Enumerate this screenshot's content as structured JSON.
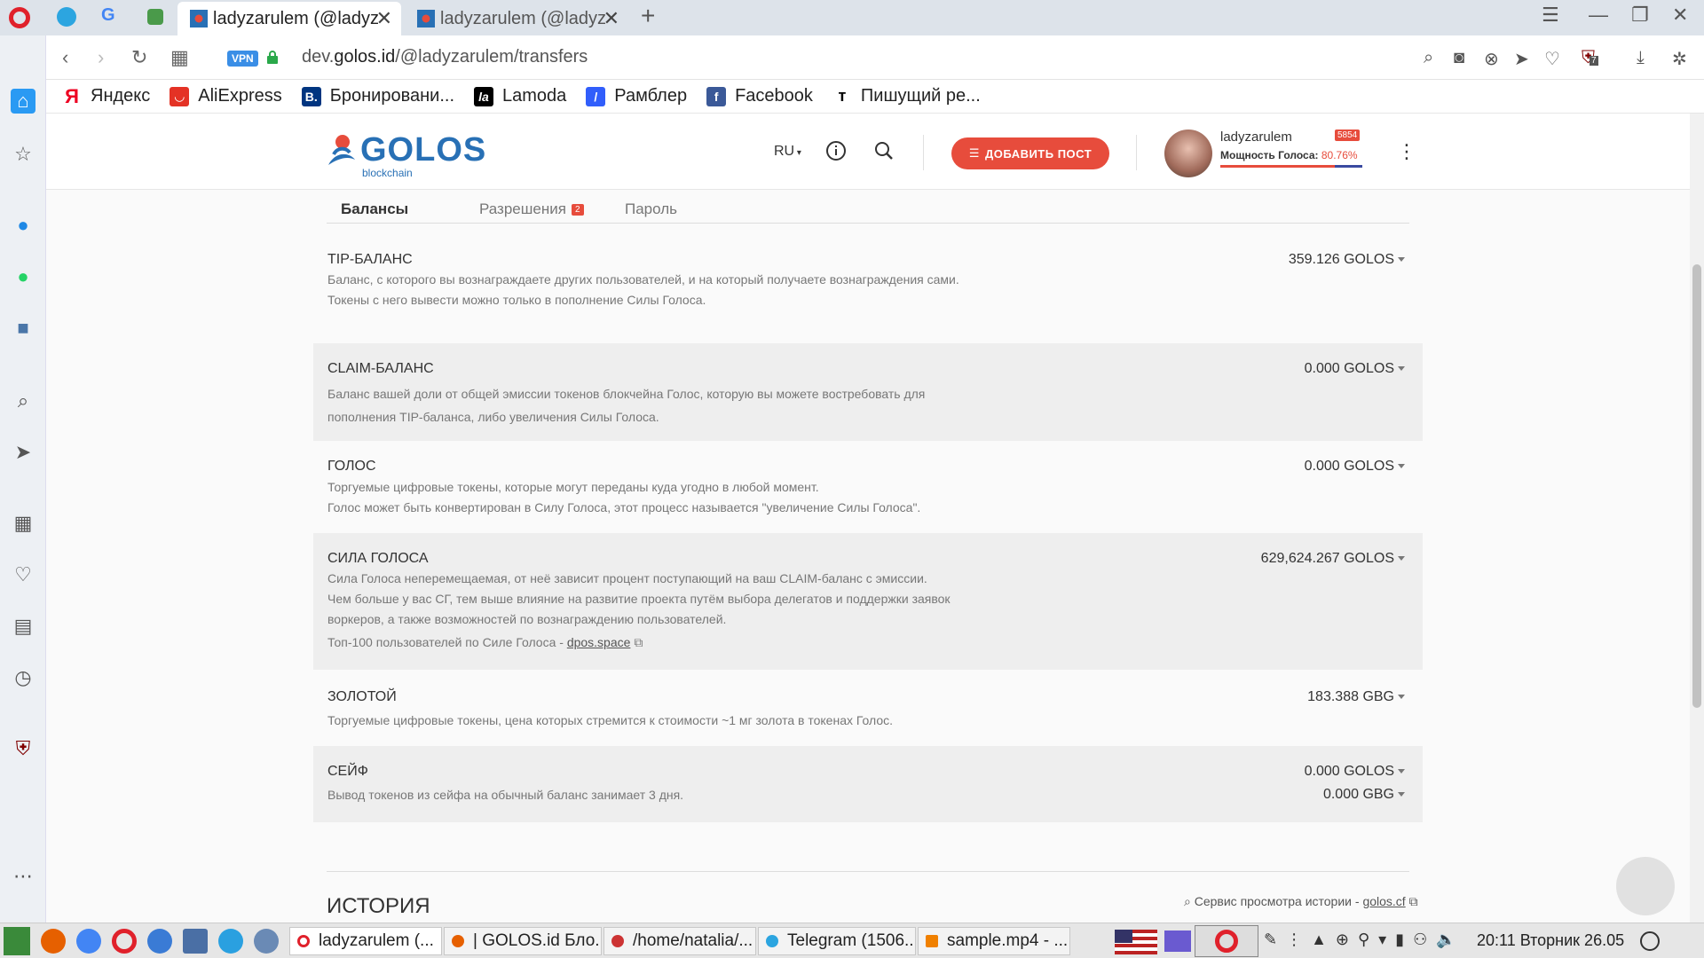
{
  "browser": {
    "tabs": [
      {
        "label": "ladyzarulem (@ladyz",
        "active": true
      },
      {
        "label": "ladyzarulem (@ladyz",
        "active": false
      }
    ],
    "url_prefix": "dev.",
    "url_domain": "golos.id",
    "url_path": "/@ladyzarulem/transfers",
    "vpn_label": "VPN",
    "bookmarks": [
      {
        "label": "Яндекс",
        "icon": "yandex-icon"
      },
      {
        "label": "AliExpress",
        "icon": "aliexpress-icon"
      },
      {
        "label": "Бронировани...",
        "icon": "booking-icon"
      },
      {
        "label": "Lamoda",
        "icon": "lamoda-icon"
      },
      {
        "label": "Рамблер",
        "icon": "rambler-icon"
      },
      {
        "label": "Facebook",
        "icon": "facebook-icon"
      },
      {
        "label": "Пишущий ре...",
        "icon": "tpublisher-icon"
      }
    ],
    "adblock_count": "7"
  },
  "site": {
    "logo_text": "GOLOS",
    "logo_sub": "blockchain",
    "lang": "RU",
    "add_post": "ДОБАВИТЬ ПОСТ",
    "username": "ladyzarulem",
    "rep_badge": "5854",
    "power_label": "Мощность Голоса:",
    "power_value": "80.76%",
    "power_fraction": 0.8076
  },
  "tabs": {
    "balances": "Балансы",
    "permissions": "Разрешения",
    "permissions_count": "2",
    "password": "Пароль"
  },
  "balances": [
    {
      "title": "TIP-БАЛАНС",
      "value": "359.126 GOLOS",
      "lines": [
        "Баланс, с которого вы вознаграждаете других пользователей, и на который получаете вознаграждения сами.",
        "Токены с него вывести можно только в пополнение Силы Голоса."
      ]
    },
    {
      "title": "CLAIM-БАЛАНС",
      "value": "0.000 GOLOS",
      "lines": [
        "Баланс вашей доли от общей эмиссии токенов блокчейна Голос, которую вы можете востребовать для",
        "пополнения TIP-баланса, либо увеличения Силы Голоса."
      ]
    },
    {
      "title": "ГОЛОС",
      "value": "0.000 GOLOS",
      "lines": [
        "Торгуемые цифровые токены, которые могут переданы куда угодно в любой момент.",
        "Голос может быть конвертирован в Силу Голоса, этот процесс называется \"увеличение Силы Голоса\"."
      ]
    },
    {
      "title": "СИЛА ГОЛОСА",
      "value": "629,624.267 GOLOS",
      "lines": [
        "Сила Голоса неперемещаемая, от неё зависит процент поступающий на ваш CLAIM-баланс с эмиссии.",
        "Чем больше у вас СГ, тем выше влияние на развитие проекта путём выбора делегатов и поддержки заявок",
        "воркеров, а также возможностей по вознаграждению пользователей."
      ],
      "top_text": "Топ-100 пользователей по Силе Голоса - ",
      "top_link": "dpos.space"
    },
    {
      "title": "ЗОЛОТОЙ",
      "value": "183.388 GBG",
      "lines": [
        "Торгуемые цифровые токены, цена которых стремится к стоимости ~1 мг золота в токенах Голос."
      ]
    },
    {
      "title": "СЕЙФ",
      "value": "0.000 GOLOS",
      "value2": "0.000 GBG",
      "lines": [
        "Вывод токенов из сейфа на обычный баланс занимает 3 дня."
      ]
    }
  ],
  "history": {
    "title": "ИСТОРИЯ",
    "service_text": "Сервис просмотра истории - ",
    "service_link": "golos.cf"
  },
  "taskbar": {
    "tasks": [
      {
        "label": "ladyzarulem (...",
        "active": true
      },
      {
        "label": "| GOLOS.id Бло...",
        "active": false
      },
      {
        "label": "/home/natalia/...",
        "active": false
      },
      {
        "label": "Telegram (1506...",
        "active": false
      },
      {
        "label": "sample.mp4 - ...",
        "active": false
      }
    ],
    "clock": "20:11 Вторник 26.05"
  },
  "colors": {
    "accent": "#e74c3c",
    "brand": "#2870b5"
  }
}
